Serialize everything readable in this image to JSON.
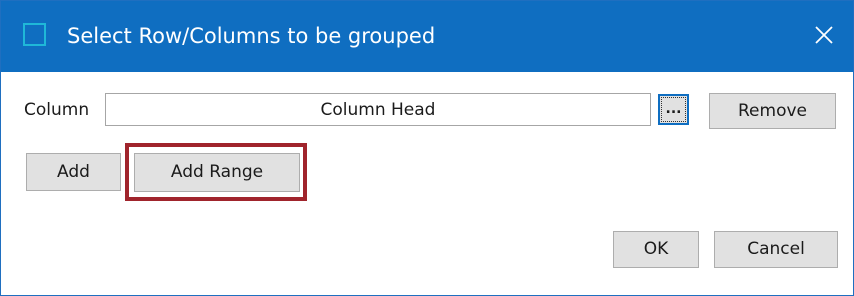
{
  "dialog": {
    "title": "Select Row/Columns to be grouped",
    "close_symbol": "✕"
  },
  "column_row": {
    "label": "Column",
    "value": "Column Head",
    "browse_label": "...",
    "remove_label": "Remove"
  },
  "actions": {
    "add_label": "Add",
    "add_range_label": "Add Range"
  },
  "footer": {
    "ok_label": "OK",
    "cancel_label": "Cancel"
  },
  "colors": {
    "titlebar": "#0f6ec1",
    "highlight": "#a0242c",
    "button_bg": "#e1e1e1"
  }
}
